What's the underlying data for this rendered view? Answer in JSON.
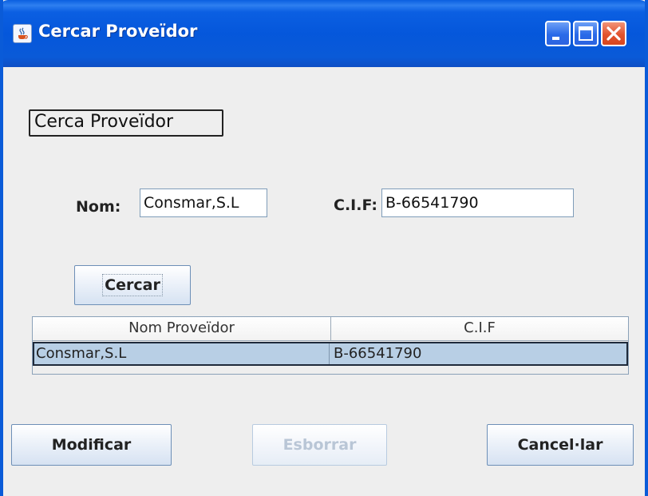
{
  "window": {
    "title": "Cercar Proveïdor",
    "app_icon": "java-cup-icon",
    "controls": {
      "minimize": "minimize-icon",
      "maximize": "maximize-icon",
      "close": "close-icon"
    },
    "accent_color": "#0a5bd8",
    "close_color": "#e2532e"
  },
  "section": {
    "title": "Cerca Proveïdor"
  },
  "form": {
    "nom_label": "Nom:",
    "nom_value": "Consmar,S.L",
    "cif_label": "C.I.F:",
    "cif_value": "B-66541790",
    "search_button": "Cercar"
  },
  "table": {
    "columns": [
      "Nom Proveïdor",
      "C.I.F"
    ],
    "rows": [
      [
        "Consmar,S.L",
        "B-66541790"
      ]
    ],
    "selected_row_color": "#b8cfe5"
  },
  "actions": {
    "modify": "Modificar",
    "delete": "Esborrar",
    "delete_enabled": false,
    "cancel": "Cancel·lar"
  }
}
